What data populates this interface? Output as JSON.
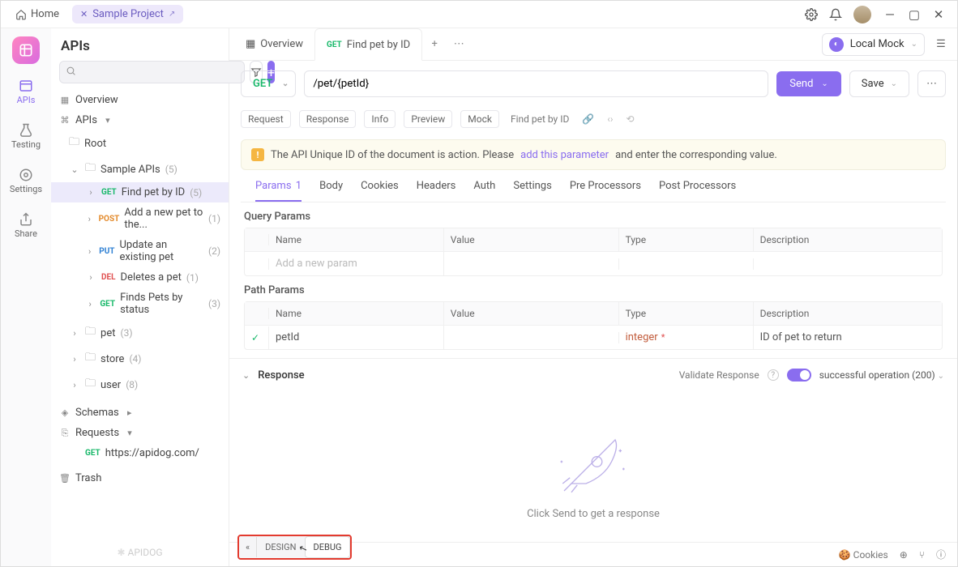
{
  "titlebar": {
    "home_label": "Home",
    "project_label": "Sample Project"
  },
  "rail": {
    "apis": "APIs",
    "testing": "Testing",
    "settings": "Settings",
    "share": "Share"
  },
  "sidebar": {
    "title": "APIs",
    "overview": "Overview",
    "apis_label": "APIs",
    "root": "Root",
    "sample_apis": {
      "label": "Sample APIs",
      "count": "(5)"
    },
    "items": [
      {
        "method": "GET",
        "label": "Find pet by ID",
        "count": "(5)"
      },
      {
        "method": "POST",
        "label": "Add a new pet to the...",
        "count": "(1)"
      },
      {
        "method": "PUT",
        "label": "Update an existing pet",
        "count": "(2)"
      },
      {
        "method": "DEL",
        "label": "Deletes a pet",
        "count": "(1)"
      },
      {
        "method": "GET",
        "label": "Finds Pets by status",
        "count": "(3)"
      }
    ],
    "folders": [
      {
        "label": "pet",
        "count": "(3)"
      },
      {
        "label": "store",
        "count": "(4)"
      },
      {
        "label": "user",
        "count": "(8)"
      }
    ],
    "schemas": "Schemas",
    "requests": "Requests",
    "request_item": {
      "method": "GET",
      "label": "https://apidog.com/"
    },
    "trash": "Trash",
    "footer_brand": "APIDOG"
  },
  "tabs": {
    "overview": "Overview",
    "current": {
      "method": "GET",
      "label": "Find pet by ID"
    }
  },
  "env": {
    "label": "Local Mock"
  },
  "request": {
    "method": "GET",
    "url": "/pet/{petId}",
    "send": "Send",
    "save": "Save"
  },
  "subtabs": {
    "request": "Request",
    "response": "Response",
    "info": "Info",
    "preview": "Preview",
    "mock": "Mock",
    "crumb": "Find pet by ID"
  },
  "banner": {
    "pre": "The API Unique ID of the document is action. Please",
    "link": "add this parameter",
    "post": "and enter the corresponding value."
  },
  "paramtabs": {
    "params": "Params",
    "params_count": "1",
    "body": "Body",
    "cookies": "Cookies",
    "headers": "Headers",
    "auth": "Auth",
    "settings": "Settings",
    "pre": "Pre Processors",
    "post": "Post Processors"
  },
  "query": {
    "title": "Query Params",
    "cols": {
      "name": "Name",
      "value": "Value",
      "type": "Type",
      "desc": "Description"
    },
    "placeholder": "Add a new param"
  },
  "path": {
    "title": "Path Params",
    "cols": {
      "name": "Name",
      "value": "Value",
      "type": "Type",
      "desc": "Description"
    },
    "row": {
      "name": "petId",
      "value": "",
      "type": "integer",
      "desc": "ID of pet to return"
    }
  },
  "response": {
    "title": "Response",
    "validate": "Validate Response",
    "status": "successful operation (200)",
    "empty": "Click Send to get a response"
  },
  "modebar": {
    "design": "DESIGN",
    "debug": "DEBUG"
  },
  "statusbar": {
    "cookies": "Cookies"
  }
}
